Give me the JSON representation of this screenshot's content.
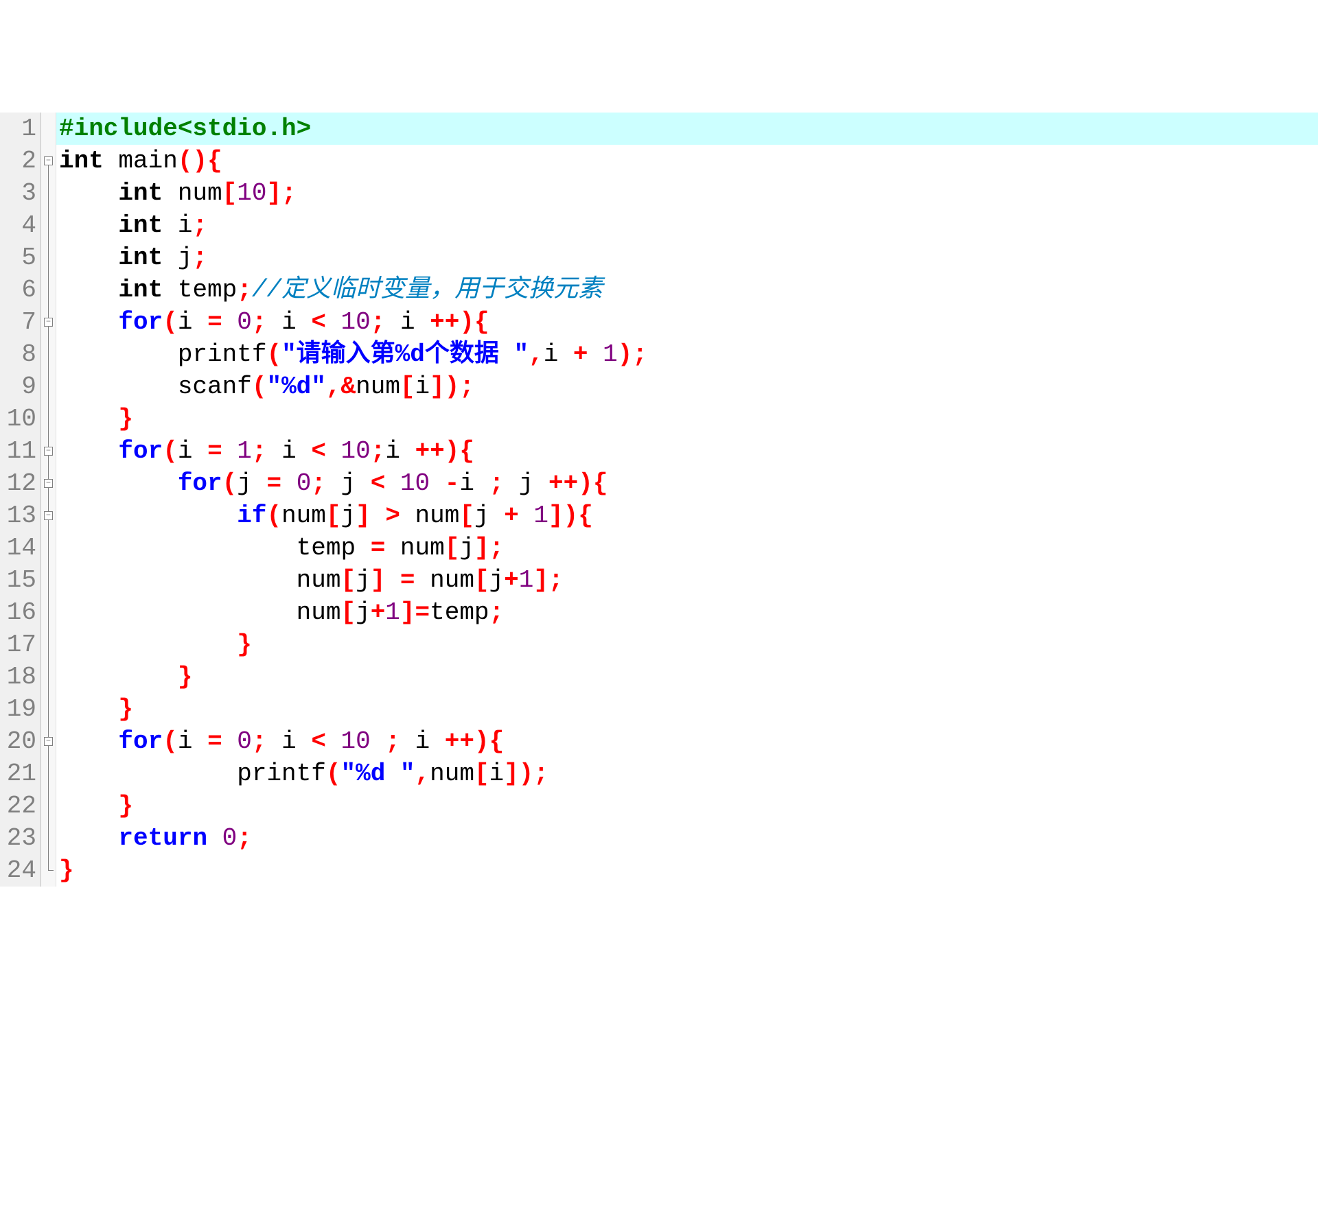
{
  "code": {
    "lines": [
      {
        "n": 1,
        "fold": "none",
        "tokens": [
          [
            "pp",
            "#include<stdio.h>"
          ]
        ],
        "highlight": true
      },
      {
        "n": 2,
        "fold": "open",
        "tokens": [
          [
            "type",
            "int"
          ],
          [
            "id",
            " main"
          ],
          [
            "br",
            "()"
          ],
          [
            "br",
            "{"
          ]
        ]
      },
      {
        "n": 3,
        "fold": "line",
        "tokens": [
          [
            "id",
            "    "
          ],
          [
            "type",
            "int"
          ],
          [
            "id",
            " num"
          ],
          [
            "br",
            "["
          ],
          [
            "num",
            "10"
          ],
          [
            "br",
            "]"
          ],
          [
            "punc",
            ";"
          ]
        ]
      },
      {
        "n": 4,
        "fold": "line",
        "tokens": [
          [
            "id",
            "    "
          ],
          [
            "type",
            "int"
          ],
          [
            "id",
            " i"
          ],
          [
            "punc",
            ";"
          ]
        ]
      },
      {
        "n": 5,
        "fold": "line",
        "tokens": [
          [
            "id",
            "    "
          ],
          [
            "type",
            "int"
          ],
          [
            "id",
            " j"
          ],
          [
            "punc",
            ";"
          ]
        ]
      },
      {
        "n": 6,
        "fold": "line",
        "tokens": [
          [
            "id",
            "    "
          ],
          [
            "type",
            "int"
          ],
          [
            "id",
            " temp"
          ],
          [
            "punc",
            ";"
          ],
          [
            "cmt",
            "//定义临时变量，用于交换元素"
          ]
        ]
      },
      {
        "n": 7,
        "fold": "open",
        "tokens": [
          [
            "id",
            "    "
          ],
          [
            "kw",
            "for"
          ],
          [
            "br",
            "("
          ],
          [
            "id",
            "i "
          ],
          [
            "op",
            "="
          ],
          [
            "id",
            " "
          ],
          [
            "num",
            "0"
          ],
          [
            "punc",
            ";"
          ],
          [
            "id",
            " i "
          ],
          [
            "op",
            "<"
          ],
          [
            "id",
            " "
          ],
          [
            "num",
            "10"
          ],
          [
            "punc",
            ";"
          ],
          [
            "id",
            " i "
          ],
          [
            "op",
            "++"
          ],
          [
            "br",
            ")"
          ],
          [
            "br",
            "{"
          ]
        ]
      },
      {
        "n": 8,
        "fold": "line",
        "tokens": [
          [
            "id",
            "        printf"
          ],
          [
            "br",
            "("
          ],
          [
            "str",
            "\"请输入第%d个数据 \""
          ],
          [
            "punc",
            ","
          ],
          [
            "id",
            "i "
          ],
          [
            "op",
            "+"
          ],
          [
            "id",
            " "
          ],
          [
            "num",
            "1"
          ],
          [
            "br",
            ")"
          ],
          [
            "punc",
            ";"
          ]
        ]
      },
      {
        "n": 9,
        "fold": "line",
        "tokens": [
          [
            "id",
            "        scanf"
          ],
          [
            "br",
            "("
          ],
          [
            "str",
            "\"%d\""
          ],
          [
            "punc",
            ","
          ],
          [
            "op",
            "&"
          ],
          [
            "id",
            "num"
          ],
          [
            "br",
            "["
          ],
          [
            "id",
            "i"
          ],
          [
            "br",
            "]"
          ],
          [
            "br",
            ")"
          ],
          [
            "punc",
            ";"
          ]
        ]
      },
      {
        "n": 10,
        "fold": "line",
        "tokens": [
          [
            "id",
            "    "
          ],
          [
            "br",
            "}"
          ]
        ]
      },
      {
        "n": 11,
        "fold": "open",
        "tokens": [
          [
            "id",
            "    "
          ],
          [
            "kw",
            "for"
          ],
          [
            "br",
            "("
          ],
          [
            "id",
            "i "
          ],
          [
            "op",
            "="
          ],
          [
            "id",
            " "
          ],
          [
            "num",
            "1"
          ],
          [
            "punc",
            ";"
          ],
          [
            "id",
            " i "
          ],
          [
            "op",
            "<"
          ],
          [
            "id",
            " "
          ],
          [
            "num",
            "10"
          ],
          [
            "punc",
            ";"
          ],
          [
            "id",
            "i "
          ],
          [
            "op",
            "++"
          ],
          [
            "br",
            ")"
          ],
          [
            "br",
            "{"
          ]
        ]
      },
      {
        "n": 12,
        "fold": "open",
        "tokens": [
          [
            "id",
            "        "
          ],
          [
            "kw",
            "for"
          ],
          [
            "br",
            "("
          ],
          [
            "id",
            "j "
          ],
          [
            "op",
            "="
          ],
          [
            "id",
            " "
          ],
          [
            "num",
            "0"
          ],
          [
            "punc",
            ";"
          ],
          [
            "id",
            " j "
          ],
          [
            "op",
            "<"
          ],
          [
            "id",
            " "
          ],
          [
            "num",
            "10"
          ],
          [
            "id",
            " "
          ],
          [
            "op",
            "-"
          ],
          [
            "id",
            "i "
          ],
          [
            "punc",
            ";"
          ],
          [
            "id",
            " j "
          ],
          [
            "op",
            "++"
          ],
          [
            "br",
            ")"
          ],
          [
            "br",
            "{"
          ]
        ]
      },
      {
        "n": 13,
        "fold": "open",
        "tokens": [
          [
            "id",
            "            "
          ],
          [
            "kw",
            "if"
          ],
          [
            "br",
            "("
          ],
          [
            "id",
            "num"
          ],
          [
            "br",
            "["
          ],
          [
            "id",
            "j"
          ],
          [
            "br",
            "]"
          ],
          [
            "id",
            " "
          ],
          [
            "op",
            ">"
          ],
          [
            "id",
            " num"
          ],
          [
            "br",
            "["
          ],
          [
            "id",
            "j "
          ],
          [
            "op",
            "+"
          ],
          [
            "id",
            " "
          ],
          [
            "num",
            "1"
          ],
          [
            "br",
            "]"
          ],
          [
            "br",
            ")"
          ],
          [
            "br",
            "{"
          ]
        ]
      },
      {
        "n": 14,
        "fold": "line",
        "tokens": [
          [
            "id",
            "                temp "
          ],
          [
            "op",
            "="
          ],
          [
            "id",
            " num"
          ],
          [
            "br",
            "["
          ],
          [
            "id",
            "j"
          ],
          [
            "br",
            "]"
          ],
          [
            "punc",
            ";"
          ]
        ]
      },
      {
        "n": 15,
        "fold": "line",
        "tokens": [
          [
            "id",
            "                num"
          ],
          [
            "br",
            "["
          ],
          [
            "id",
            "j"
          ],
          [
            "br",
            "]"
          ],
          [
            "id",
            " "
          ],
          [
            "op",
            "="
          ],
          [
            "id",
            " num"
          ],
          [
            "br",
            "["
          ],
          [
            "id",
            "j"
          ],
          [
            "op",
            "+"
          ],
          [
            "num",
            "1"
          ],
          [
            "br",
            "]"
          ],
          [
            "punc",
            ";"
          ]
        ]
      },
      {
        "n": 16,
        "fold": "line",
        "tokens": [
          [
            "id",
            "                num"
          ],
          [
            "br",
            "["
          ],
          [
            "id",
            "j"
          ],
          [
            "op",
            "+"
          ],
          [
            "num",
            "1"
          ],
          [
            "br",
            "]"
          ],
          [
            "op",
            "="
          ],
          [
            "id",
            "temp"
          ],
          [
            "punc",
            ";"
          ]
        ]
      },
      {
        "n": 17,
        "fold": "line",
        "tokens": [
          [
            "id",
            "            "
          ],
          [
            "br",
            "}"
          ]
        ]
      },
      {
        "n": 18,
        "fold": "line",
        "tokens": [
          [
            "id",
            "        "
          ],
          [
            "br",
            "}"
          ]
        ]
      },
      {
        "n": 19,
        "fold": "line",
        "tokens": [
          [
            "id",
            "    "
          ],
          [
            "br",
            "}"
          ]
        ]
      },
      {
        "n": 20,
        "fold": "open",
        "tokens": [
          [
            "id",
            "    "
          ],
          [
            "kw",
            "for"
          ],
          [
            "br",
            "("
          ],
          [
            "id",
            "i "
          ],
          [
            "op",
            "="
          ],
          [
            "id",
            " "
          ],
          [
            "num",
            "0"
          ],
          [
            "punc",
            ";"
          ],
          [
            "id",
            " i "
          ],
          [
            "op",
            "<"
          ],
          [
            "id",
            " "
          ],
          [
            "num",
            "10"
          ],
          [
            "id",
            " "
          ],
          [
            "punc",
            ";"
          ],
          [
            "id",
            " i "
          ],
          [
            "op",
            "++"
          ],
          [
            "br",
            ")"
          ],
          [
            "br",
            "{"
          ]
        ]
      },
      {
        "n": 21,
        "fold": "line",
        "tokens": [
          [
            "id",
            "            printf"
          ],
          [
            "br",
            "("
          ],
          [
            "str",
            "\"%d \""
          ],
          [
            "punc",
            ","
          ],
          [
            "id",
            "num"
          ],
          [
            "br",
            "["
          ],
          [
            "id",
            "i"
          ],
          [
            "br",
            "]"
          ],
          [
            "br",
            ")"
          ],
          [
            "punc",
            ";"
          ]
        ]
      },
      {
        "n": 22,
        "fold": "line",
        "tokens": [
          [
            "id",
            "    "
          ],
          [
            "br",
            "}"
          ]
        ]
      },
      {
        "n": 23,
        "fold": "line",
        "tokens": [
          [
            "id",
            "    "
          ],
          [
            "kw",
            "return"
          ],
          [
            "id",
            " "
          ],
          [
            "num",
            "0"
          ],
          [
            "punc",
            ";"
          ]
        ]
      },
      {
        "n": 24,
        "fold": "end",
        "tokens": [
          [
            "br",
            "}"
          ]
        ]
      }
    ]
  }
}
